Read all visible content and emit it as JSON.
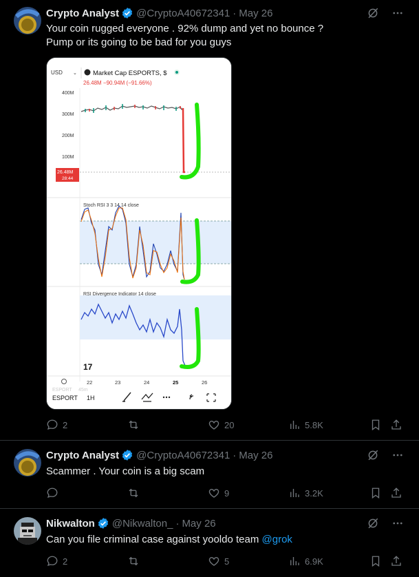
{
  "tweets": [
    {
      "name": "Crypto Analyst",
      "handle": "@CryptoA40672341",
      "date": "May 26",
      "line1": "Your coin rugged everyone . 92% dump and yet no bounce ?",
      "line2": "Pump or its going to be bad for you guys",
      "replies": "2",
      "retweets": "",
      "likes": "20",
      "views": "5.8K"
    },
    {
      "name": "Crypto Analyst",
      "handle": "@CryptoA40672341",
      "date": "May 26",
      "line1": "Scammer . Your coin is a big scam",
      "replies": "",
      "retweets": "",
      "likes": "9",
      "views": "3.2K"
    },
    {
      "name": "Nikwalton",
      "handle": "@Nikwalton_",
      "date": "May 26",
      "line1": "Can you file criminal case against yooldo team",
      "mention": "@grok",
      "replies": "2",
      "retweets": "",
      "likes": "5",
      "views": "6.9K"
    }
  ],
  "chart_image": {
    "currency": "USD",
    "title": "Market Cap ESPORTS, $",
    "subtitle": "26.48M −90.94M (−91.66%)",
    "y_ticks": [
      "400M",
      "300M",
      "200M",
      "100M"
    ],
    "price_tag": "26.48M",
    "price_tag_time": "28:44",
    "stoch_label": "Stoch RSI 3 3 14 14 close",
    "rsi_label": "RSI Divergence Indicator 14 close",
    "x_ticks": [
      "22",
      "23",
      "24",
      "25",
      "26"
    ],
    "symbol": "ESPORT",
    "interval": "1H",
    "ghost1": "ESPORT",
    "ghost2": "45m",
    "logo": "17"
  },
  "colors": {
    "accent": "#1d9bf0",
    "muted": "#71767b",
    "verified": "#1d9bf0",
    "drop_red": "#e53935",
    "green_marker": "#22e60a"
  }
}
